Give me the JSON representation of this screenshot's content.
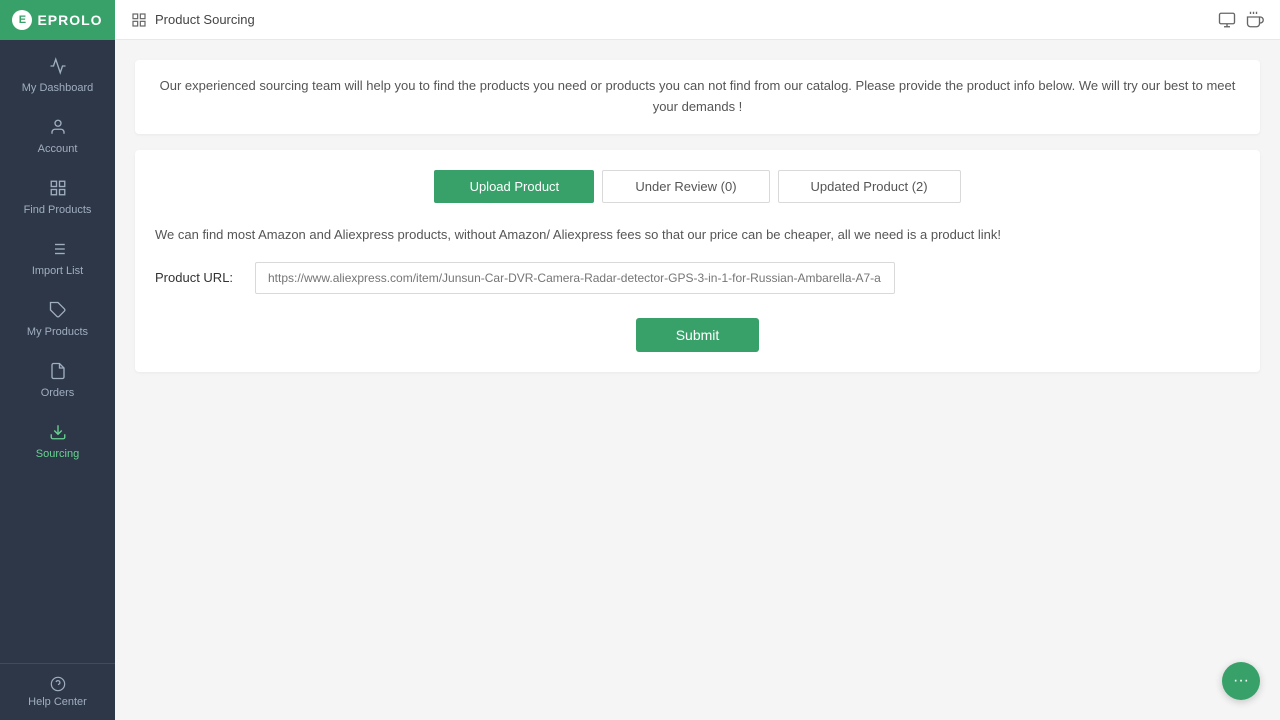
{
  "sidebar": {
    "logo": {
      "icon": "E",
      "text": "EPROLO"
    },
    "items": [
      {
        "id": "dashboard",
        "label": "My Dashboard",
        "icon": "chart"
      },
      {
        "id": "account",
        "label": "Account",
        "icon": "user"
      },
      {
        "id": "find-products",
        "label": "Find Products",
        "icon": "grid"
      },
      {
        "id": "import-list",
        "label": "Import List",
        "icon": "list"
      },
      {
        "id": "my-products",
        "label": "My Products",
        "icon": "tag"
      },
      {
        "id": "orders",
        "label": "Orders",
        "icon": "file"
      },
      {
        "id": "sourcing",
        "label": "Sourcing",
        "icon": "download",
        "active": true
      }
    ],
    "help": {
      "label": "Help Center",
      "icon": "help-circle"
    }
  },
  "topbar": {
    "page_icon": "grid",
    "title": "Product Sourcing",
    "actions": [
      "screen",
      "share"
    ]
  },
  "banner": {
    "text": "Our experienced sourcing team will help you to find the products you need or products you can not find from our catalog. Please provide the product info below. We will try our best to meet your demands !"
  },
  "tabs": [
    {
      "id": "upload",
      "label": "Upload Product",
      "count": null,
      "active": true
    },
    {
      "id": "under-review",
      "label": "Under Review (0)",
      "count": 0,
      "active": false
    },
    {
      "id": "updated-product",
      "label": "Updated Product (2)",
      "count": 2,
      "active": false
    }
  ],
  "upload_form": {
    "description": "We can find most Amazon and Aliexpress products, without Amazon/ Aliexpress fees so that our price can be cheaper, all we need is a product link!",
    "product_url_label": "Product URL:",
    "product_url_placeholder": "https://www.aliexpress.com/item/Junsun-Car-DVR-Camera-Radar-detector-GPS-3-in-1-for-Russian-Ambarella-A7-a...",
    "submit_label": "Submit"
  }
}
